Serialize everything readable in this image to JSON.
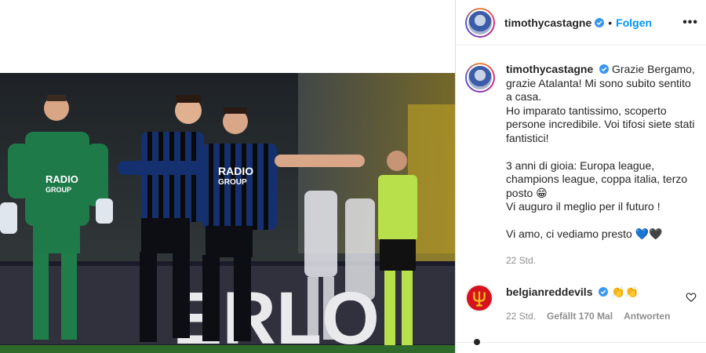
{
  "post": {
    "username": "timothycastagne",
    "follow_label": "Folgen",
    "dot": "•",
    "more_label": "•••",
    "caption": {
      "lines_block1": [
        "Grazie Bergamo,",
        "grazie Atalanta! Mi sono subito sentito",
        "a casa.",
        "Ho imparato tantissimo, scoperto",
        "persone incredibile. Voi tifosi siete stati",
        "fantistici!"
      ],
      "lines_block2": [
        "3 anni di gioia: Europa league,",
        "champions league, coppa italia, terzo",
        "posto 😁",
        "Vi auguro il meglio per il futuro !"
      ],
      "lines_block3": [
        "Vi amo, ci vediamo presto 💙🖤"
      ]
    },
    "timestamp": "22 Std."
  },
  "photo": {
    "jersey_text_1": "RADIO",
    "jersey_text_2": "GROUP",
    "keeper_text_1": "RADIO",
    "keeper_text_2": "GROUP",
    "board_text": "ERLO"
  },
  "comment": {
    "username": "belgianreddevils",
    "emoji": "👏👏",
    "time": "22 Std.",
    "likes": "Gefällt 170 Mal",
    "reply": "Antworten"
  },
  "colors": {
    "accent": "#0095f6",
    "verified": "#3897f0",
    "text": "#262626",
    "muted": "#8e8e8e"
  }
}
